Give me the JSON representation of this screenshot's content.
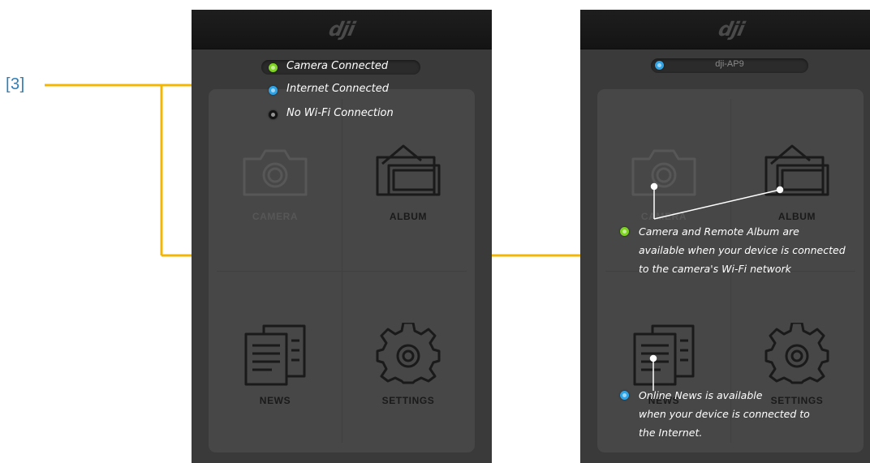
{
  "callout": {
    "label": "[3]",
    "line_color": "#f2b705"
  },
  "logo_text": "dji",
  "colors": {
    "green": "#7ed321",
    "blue": "#2ea3e6",
    "black": "#141414",
    "active_label": "#1a1a1a",
    "inactive_label": "#575757",
    "annotation_line": "#ffffff"
  },
  "left_screen": {
    "legend": [
      {
        "status": "green",
        "label": "Camera Connected"
      },
      {
        "status": "blue",
        "label": "Internet Connected"
      },
      {
        "status": "black",
        "label": "No Wi-Fi Connection"
      }
    ],
    "tiles": [
      {
        "label": "CAMERA",
        "icon": "camera-icon",
        "enabled": false
      },
      {
        "label": "ALBUM",
        "icon": "album-icon",
        "enabled": true
      },
      {
        "label": "NEWS",
        "icon": "news-icon",
        "enabled": true
      },
      {
        "label": "SETTINGS",
        "icon": "gear-icon",
        "enabled": true
      }
    ]
  },
  "right_screen": {
    "wifi_ssid": "dji-AP9",
    "wifi_status": "blue",
    "tiles": [
      {
        "label": "CAMERA",
        "icon": "camera-icon",
        "enabled": false
      },
      {
        "label": "ALBUM",
        "icon": "album-icon",
        "enabled": true
      },
      {
        "label": "NEWS",
        "icon": "news-icon",
        "enabled": true
      },
      {
        "label": "SETTINGS",
        "icon": "gear-icon",
        "enabled": true
      }
    ],
    "notes": [
      {
        "status": "green",
        "lines": [
          "Camera and Remote Album are",
          "available when your device is connected",
          "to the camera's Wi-Fi network"
        ]
      },
      {
        "status": "blue",
        "lines": [
          "Online News is available",
          "when your device is connected to",
          "the Internet."
        ]
      }
    ]
  }
}
